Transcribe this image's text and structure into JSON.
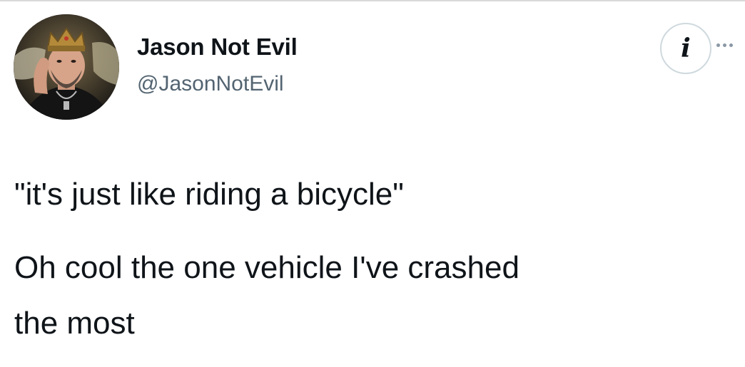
{
  "tweet": {
    "author": {
      "display_name": "Jason Not Evil",
      "handle": "@JasonNotEvil",
      "avatar_icon": "crowned-man-avatar"
    },
    "info_button": {
      "glyph": "i",
      "icon": "info-icon"
    },
    "more_icon": "more-dots-icon",
    "text_lines": [
      "\"it's just like riding a bicycle\"",
      "Oh cool the one vehicle I've crashed",
      "the most"
    ]
  },
  "colors": {
    "text": "#0f1419",
    "secondary_text": "#536471",
    "border": "#cfd9de",
    "background": "#ffffff"
  }
}
